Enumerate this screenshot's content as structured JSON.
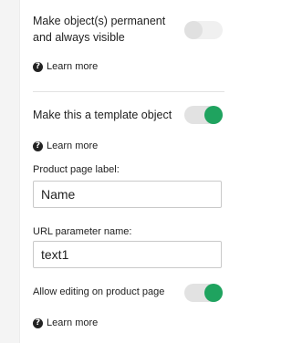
{
  "settings": {
    "permanent": {
      "label": "Make object(s) permanent and always visible",
      "enabled": false,
      "learn_more": "Learn more",
      "help_icon": "question-circle-icon"
    },
    "template": {
      "label": "Make this a template object",
      "enabled": true,
      "learn_more": "Learn more",
      "help_icon": "question-circle-icon",
      "product_page_label": {
        "label": "Product page label:",
        "value": "Name"
      },
      "url_parameter": {
        "label": "URL parameter name:",
        "value": "text1"
      },
      "allow_editing": {
        "label": "Allow editing on product page",
        "enabled": true,
        "learn_more": "Learn more",
        "help_icon": "question-circle-icon"
      }
    }
  },
  "colors": {
    "toggle_on": "#1fa35f",
    "toggle_off": "#e0e0e0"
  }
}
